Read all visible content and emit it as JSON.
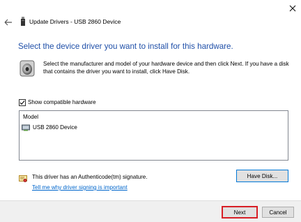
{
  "window": {
    "title": "Update Drivers - USB 2860 Device"
  },
  "page": {
    "heading": "Select the device driver you want to install for this hardware.",
    "description": "Select the manufacturer and model of your hardware device and then click Next. If you have a disk that contains the driver you want to install, click Have Disk."
  },
  "compatible": {
    "label": "Show compatible hardware",
    "checked": true
  },
  "model_list": {
    "header": "Model",
    "items": [
      "USB 2860 Device"
    ]
  },
  "signature": {
    "text": "This driver has an Authenticode(tm) signature.",
    "link": "Tell me why driver signing is important"
  },
  "buttons": {
    "have_disk": "Have Disk...",
    "next": "Next",
    "cancel": "Cancel"
  },
  "icons": {
    "close": "close-icon",
    "back": "back-arrow-icon",
    "device": "device-icon",
    "speaker": "speaker-icon",
    "certificate": "certificate-icon",
    "model_item": "hardware-icon"
  },
  "colors": {
    "heading": "#1f4fa8",
    "link": "#0066cc",
    "highlight_border": "#d81f26",
    "focus_border": "#0078d7"
  }
}
